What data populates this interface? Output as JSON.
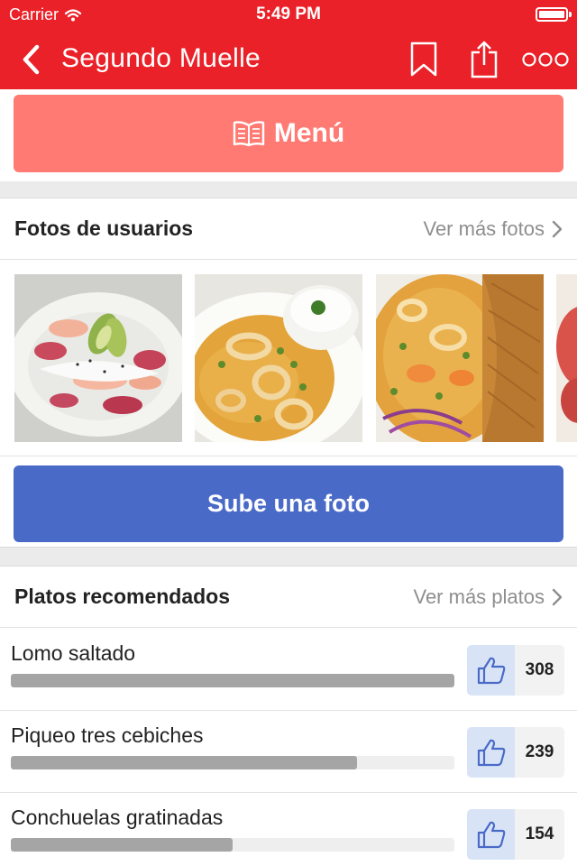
{
  "status_bar": {
    "carrier": "Carrier",
    "time": "5:49 PM"
  },
  "navbar": {
    "title": "Segundo Muelle",
    "back_icon": "chevron-left-icon",
    "bookmark_icon": "bookmark-icon",
    "share_icon": "share-icon",
    "more_icon": "more-icon"
  },
  "menu_button": {
    "label": "Menú",
    "icon": "book-icon"
  },
  "photos": {
    "title": "Fotos de usuarios",
    "more_label": "Ver más fotos",
    "items": [
      {
        "subject": "ceviche with avocado"
      },
      {
        "subject": "squid in yellow sauce with rice"
      },
      {
        "subject": "seafood rice"
      },
      {
        "subject": "partial photo"
      }
    ],
    "upload_label": "Sube una foto"
  },
  "dishes": {
    "title": "Platos recomendados",
    "more_label": "Ver más platos",
    "items": [
      {
        "name": "Lomo saltado",
        "likes": "308",
        "popularity": 1.0
      },
      {
        "name": "Piqueo tres cebiches",
        "likes": "239",
        "popularity": 0.78
      },
      {
        "name": "Conchuelas gratinadas",
        "likes": "154",
        "popularity": 0.5
      }
    ]
  },
  "colors": {
    "brand_red": "#ea2128",
    "menu_button": "#ff7a73",
    "upload_button": "#4a6ac7",
    "like_icon_bg": "#d8e4f6",
    "bar_fill": "#a5a5a5"
  }
}
